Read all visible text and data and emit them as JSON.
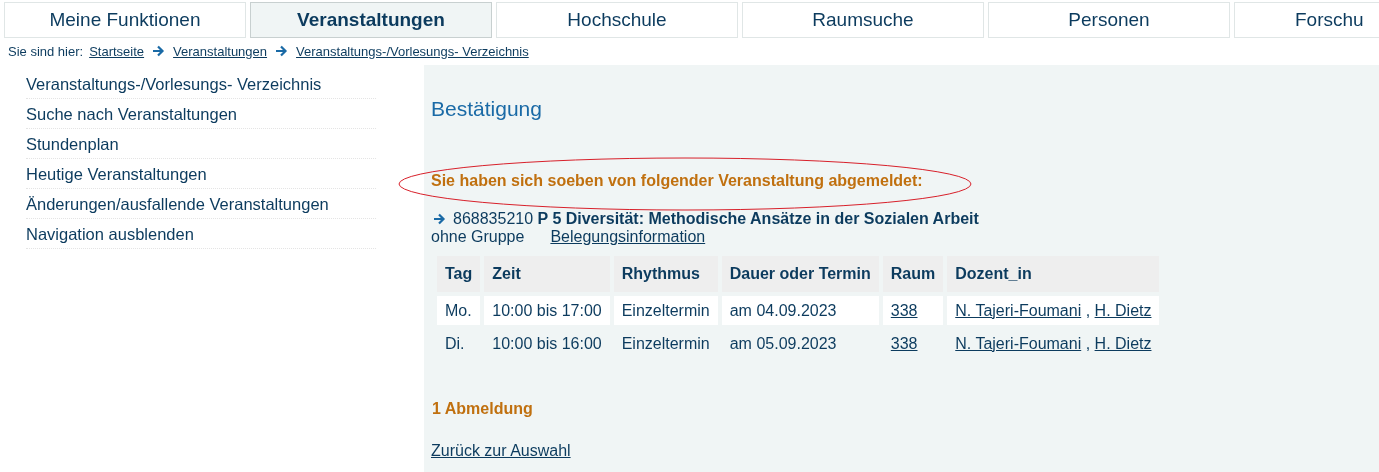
{
  "tabs": [
    {
      "label": "Meine Funktionen",
      "selected": false
    },
    {
      "label": "Veranstaltungen",
      "selected": true
    },
    {
      "label": "Hochschule",
      "selected": false
    },
    {
      "label": "Raumsuche",
      "selected": false
    },
    {
      "label": "Personen",
      "selected": false
    },
    {
      "label": "Forschu",
      "selected": false
    }
  ],
  "breadcrumb": {
    "label": "Sie sind hier:",
    "links": [
      "Startseite",
      "Veranstaltungen",
      "Veranstaltungs-/Vorlesungs- Verzeichnis"
    ]
  },
  "sidebar": {
    "items": [
      "Veranstaltungs-/Vorlesungs- Verzeichnis",
      "Suche nach Veranstaltungen",
      "Stundenplan",
      "Heutige Veranstaltungen",
      "Änderungen/ausfallende Veranstaltungen",
      "Navigation ausblenden"
    ]
  },
  "content": {
    "title": "Bestätigung",
    "message": "Sie haben sich soeben von folgender Veranstaltung abgemeldet:",
    "course": {
      "number": "868835210",
      "title": "P 5 Diversität: Methodische Ansätze in der Sozialen Arbeit",
      "group": "ohne Gruppe",
      "info_link": "Belegungsinformation"
    },
    "table": {
      "columns": [
        "Tag",
        "Zeit",
        "Rhythmus",
        "Dauer oder Termin",
        "Raum",
        "Dozent_in"
      ],
      "rows": [
        {
          "day": "Mo.",
          "time": "10:00 bis 17:00",
          "rhythm": "Einzeltermin",
          "date": "am 04.09.2023",
          "room": "338",
          "lecturers": [
            "N. Tajeri-Foumani",
            "H. Dietz"
          ],
          "separator": ","
        },
        {
          "day": "Di.",
          "time": "10:00 bis 16:00",
          "rhythm": "Einzeltermin",
          "date": "am 05.09.2023",
          "room": "338",
          "lecturers": [
            "N. Tajeri-Foumani",
            "H. Dietz"
          ],
          "separator": ","
        }
      ]
    },
    "count": "1 Abmeldung",
    "back_link": "Zurück zur Auswahl"
  }
}
